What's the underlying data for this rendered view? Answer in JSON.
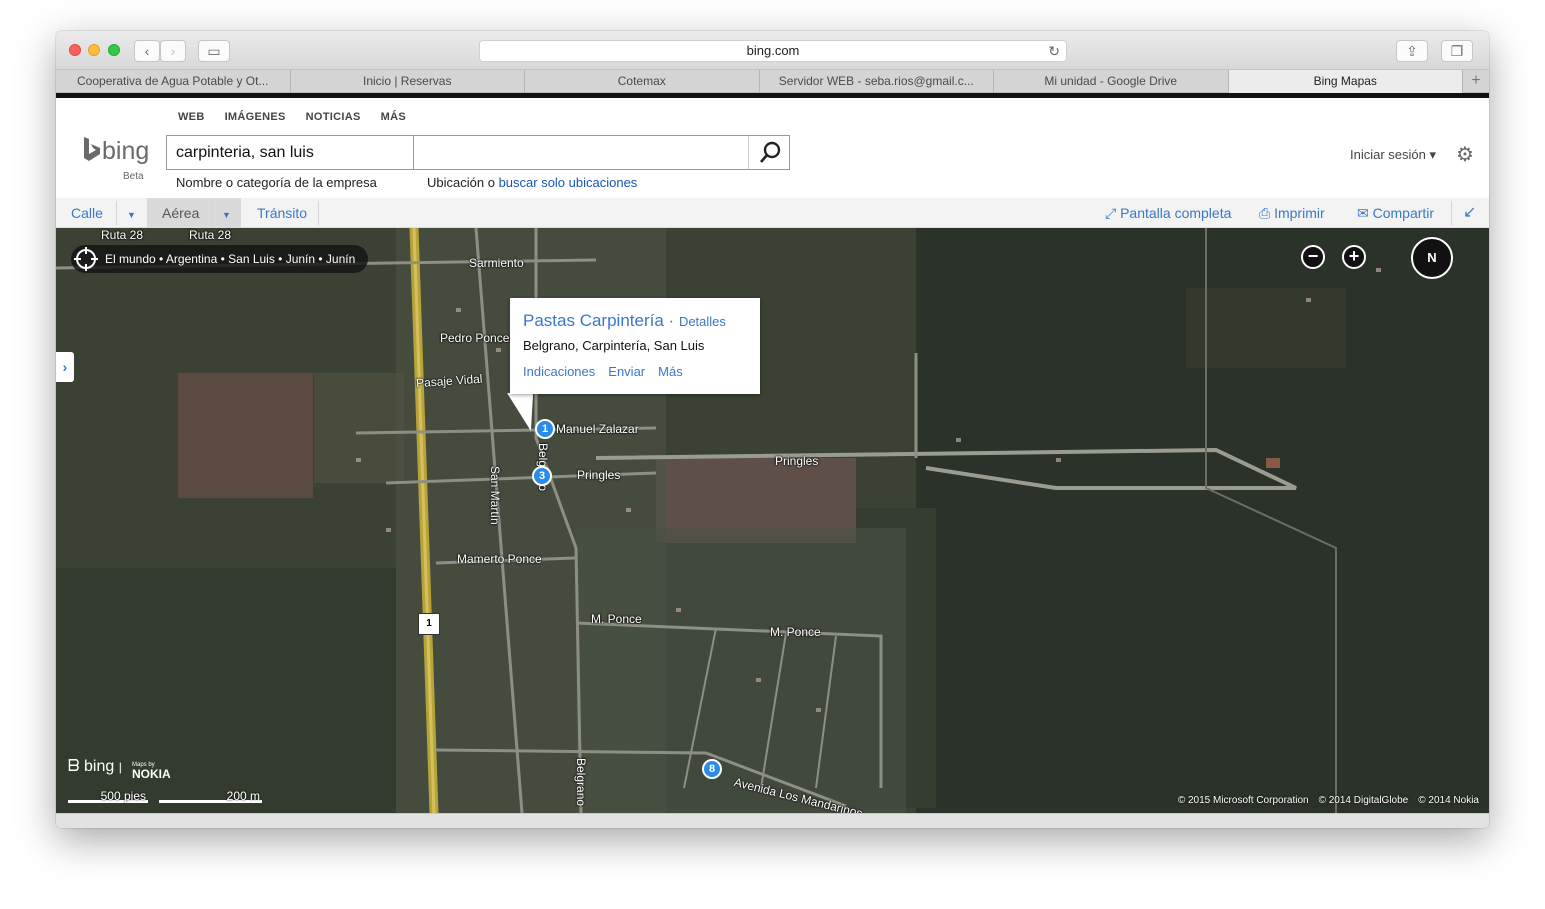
{
  "browser": {
    "url": "bing.com",
    "tabs": [
      {
        "label": "Cooperativa de Agua Potable y Ot...",
        "active": false
      },
      {
        "label": "Inicio | Reservas",
        "active": false
      },
      {
        "label": "Cotemax",
        "active": false
      },
      {
        "label": "Servidor WEB - seba.rios@gmail.c...",
        "active": false
      },
      {
        "label": "Mi unidad - Google Drive",
        "active": false
      },
      {
        "label": "Bing Mapas",
        "active": true
      }
    ],
    "new_tab_label": "+"
  },
  "header": {
    "scopes": [
      "WEB",
      "IMÁGENES",
      "NOTICIAS",
      "MÁS"
    ],
    "logo_text": "bing",
    "beta_label": "Beta",
    "query": "carpinteria, san luis",
    "location_value": "",
    "query_hint": "Nombre o categoría de la empresa",
    "location_hint_prefix": "Ubicación o",
    "location_hint_link": "buscar solo ubicaciones",
    "signin": "Iniciar sesión ▾"
  },
  "toolbar": {
    "street": "Calle",
    "aerial": "Aérea",
    "transit": "Tránsito",
    "fullscreen": "Pantalla completa",
    "print": "Imprimir",
    "share": "Compartir"
  },
  "map": {
    "breadcrumb": "El mundo • Argentina • San Luis • Junín • Junín",
    "compass_label": "N",
    "popup": {
      "title": "Pastas Carpintería",
      "separator": "·",
      "details": "Detalles",
      "address": "Belgrano, Carpintería, San Luis",
      "links": [
        "Indicaciones",
        "Enviar",
        "Más"
      ]
    },
    "pins": [
      "1",
      "3",
      "8"
    ],
    "streets": {
      "ruta28a": "Ruta 28",
      "ruta28b": "Ruta 28",
      "sarmiento": "Sarmiento",
      "pedro_ponce": "Pedro Ponce",
      "pasaje_vidal": "Pasaje Vidal",
      "manuel_zalazar": "Manuel Zalazar",
      "pringles1": "Pringles",
      "pringles2": "Pringles",
      "san_martin": "San Martín",
      "belgrano1": "Belgrano",
      "belgrano2": "Belgrano",
      "mamerto_ponce": "Mamerto Ponce",
      "m_ponce1": "M. Ponce",
      "m_ponce2": "M. Ponce",
      "mandarinos": "Avenida Los Mandarinos"
    },
    "route_shield": "1",
    "logo": "bing",
    "nokia": "NOKIA",
    "maps_by": "Maps by",
    "scale_feet": "500 pies",
    "scale_m": "200 m",
    "copyrights": [
      "© 2015 Microsoft Corporation",
      "© 2014 DigitalGlobe",
      "© 2014 Nokia"
    ]
  },
  "colors": {
    "accent": "#3a78c7",
    "pin": "#2a8be8",
    "crumb_bg": "#141414"
  }
}
